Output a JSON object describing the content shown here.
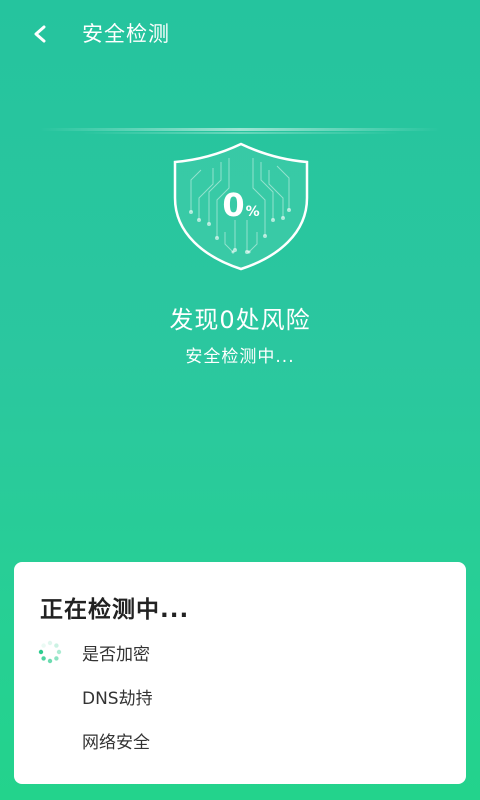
{
  "header": {
    "title": "安全检测",
    "back_icon": "chevron-left-icon"
  },
  "scan": {
    "percent_value": "0",
    "percent_unit": "%",
    "risk_text": "发现0处风险",
    "status_text": "安全检测中...",
    "shield_icon": "shield-circuit-icon"
  },
  "checklist": {
    "title": "正在检测中...",
    "items": [
      {
        "label": "是否加密",
        "state": "checking"
      },
      {
        "label": "DNS劫持",
        "state": "pending"
      },
      {
        "label": "网络安全",
        "state": "pending"
      }
    ]
  },
  "colors": {
    "background_top": "#25c49e",
    "background_bottom": "#23d38c",
    "spinner": "#2ecc8f",
    "card": "#ffffff"
  }
}
